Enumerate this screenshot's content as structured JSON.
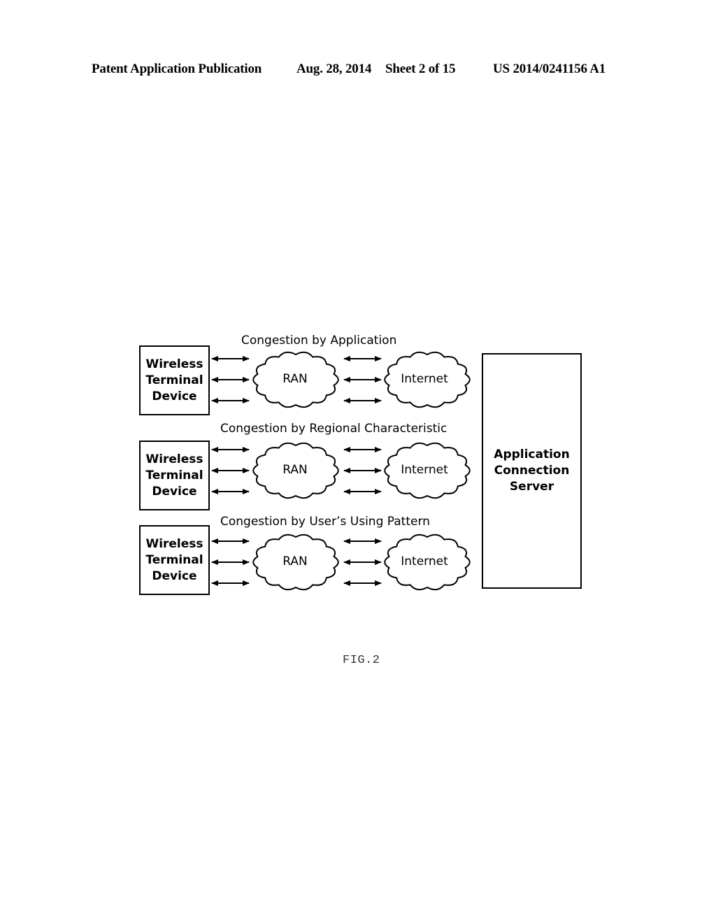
{
  "header": {
    "publication": "Patent Application Publication",
    "date": "Aug. 28, 2014",
    "sheet": "Sheet 2 of 15",
    "number": "US 2014/0241156 A1"
  },
  "figure": {
    "label": "FIG.2",
    "rows": [
      {
        "caption": "Congestion by Application",
        "device": [
          "Wireless",
          "Terminal",
          "Device"
        ],
        "ran": "RAN",
        "internet": "Internet"
      },
      {
        "caption": "Congestion by Regional Characteristic",
        "device": [
          "Wireless",
          "Terminal",
          "Device"
        ],
        "ran": "RAN",
        "internet": "Internet"
      },
      {
        "caption": "Congestion by User’s Using Pattern",
        "device": [
          "Wireless",
          "Terminal",
          "Device"
        ],
        "ran": "RAN",
        "internet": "Internet"
      }
    ],
    "server": [
      "Application",
      "Connection",
      "Server"
    ],
    "arrow_icon": "double-headed-arrow",
    "cloud_icon": "cloud"
  }
}
